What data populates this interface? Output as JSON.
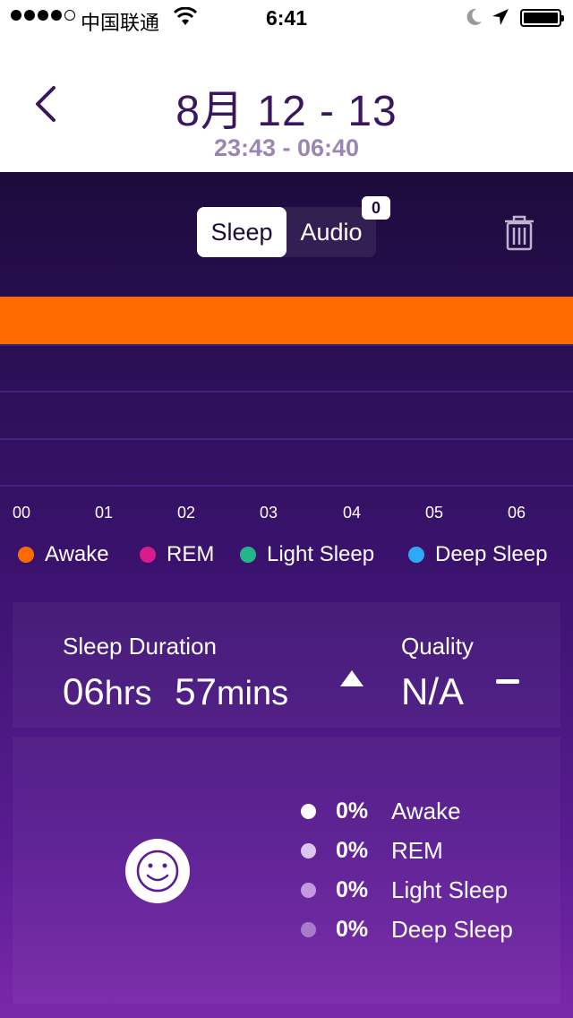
{
  "status_bar": {
    "carrier": "中国联通",
    "time": "6:41"
  },
  "header": {
    "title": "8月 12 - 13",
    "subtitle": "23:43 - 06:40"
  },
  "segment": {
    "sleep_label": "Sleep",
    "audio_label": "Audio",
    "audio_count": "0",
    "selected": "Sleep"
  },
  "chart_data": {
    "type": "bar",
    "x_ticks": [
      "00",
      "01",
      "02",
      "03",
      "04",
      "05",
      "06"
    ],
    "series": [
      {
        "name": "Awake",
        "color": "#ff6a00"
      },
      {
        "name": "REM",
        "color": "#d81b8a"
      },
      {
        "name": "Light Sleep",
        "color": "#26b58a"
      },
      {
        "name": "Deep Sleep",
        "color": "#2fa8f5"
      }
    ]
  },
  "summary": {
    "duration_label": "Sleep Duration",
    "duration_hours_value": "06",
    "duration_hours_unit": "hrs",
    "duration_mins_value": "57",
    "duration_mins_unit": "mins",
    "quality_label": "Quality",
    "quality_value": "N/A"
  },
  "breakdown": [
    {
      "pct": "0%",
      "name": "Awake",
      "dot_color": "#ffffff"
    },
    {
      "pct": "0%",
      "name": "REM",
      "dot_color": "#dcc6ee"
    },
    {
      "pct": "0%",
      "name": "Light Sleep",
      "dot_color": "#c39ae0"
    },
    {
      "pct": "0%",
      "name": "Deep Sleep",
      "dot_color": "#a77ccd"
    }
  ],
  "icons": {
    "back": "chevron-left-icon",
    "trash": "trash-icon",
    "smiley": "smiley-icon"
  }
}
